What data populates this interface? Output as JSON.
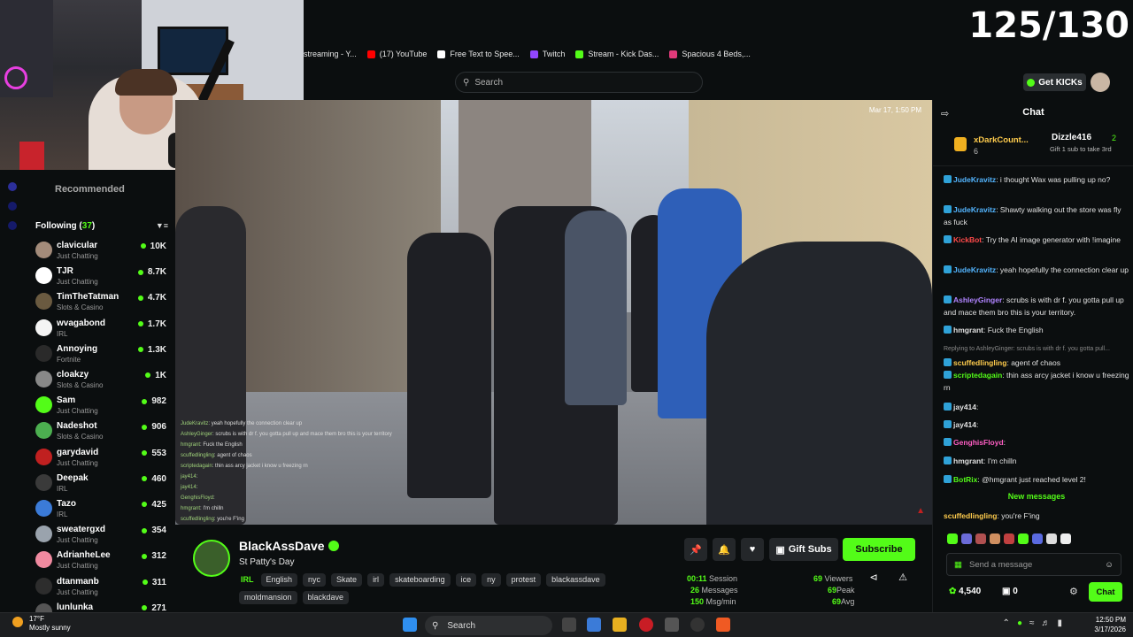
{
  "overlay": {
    "score": "125/130"
  },
  "bookmarks": [
    {
      "label": "streaming - Y...",
      "color": "#ff3d3d"
    },
    {
      "label": "(17) YouTube",
      "color": "#ff0000"
    },
    {
      "label": "Free Text to Spee...",
      "color": "#ffffff"
    },
    {
      "label": "Twitch",
      "color": "#9146ff"
    },
    {
      "label": "Stream - Kick Das...",
      "color": "#53fc18"
    },
    {
      "label": "Spacious 4 Beds,...",
      "color": "#e03a7a"
    }
  ],
  "header": {
    "search_placeholder": "Search",
    "get_kicks": "Get KICKs"
  },
  "sidebar": {
    "recommended": "Recommended",
    "following_label": "Following (",
    "following_count": "37",
    "following_close": ")",
    "channels": [
      {
        "name": "clavicular",
        "category": "Just Chatting",
        "viewers": "10K",
        "color": "#a38b7a"
      },
      {
        "name": "TJR",
        "category": "Just Chatting",
        "viewers": "8.7K",
        "color": "#ffffff"
      },
      {
        "name": "TimTheTatman",
        "category": "Slots & Casino",
        "viewers": "4.7K",
        "color": "#6a5a40"
      },
      {
        "name": "wvagabond",
        "category": "IRL",
        "viewers": "1.7K",
        "color": "#f4f4f4"
      },
      {
        "name": "Annoying",
        "category": "Fortnite",
        "viewers": "1.3K",
        "color": "#2a2a2a"
      },
      {
        "name": "cloakzy",
        "category": "Slots & Casino",
        "viewers": "1K",
        "color": "#888888"
      },
      {
        "name": "Sam",
        "category": "Just Chatting",
        "viewers": "982",
        "color": "#53fc18"
      },
      {
        "name": "Nadeshot",
        "category": "Slots & Casino",
        "viewers": "906",
        "color": "#4caf50"
      },
      {
        "name": "garydavid",
        "category": "Just Chatting",
        "viewers": "553",
        "color": "#c02020"
      },
      {
        "name": "Deepak",
        "category": "IRL",
        "viewers": "460",
        "color": "#3a3a3a"
      },
      {
        "name": "Tazo",
        "category": "IRL",
        "viewers": "425",
        "color": "#3b7bd8"
      },
      {
        "name": "sweatergxd",
        "category": "Just Chatting",
        "viewers": "354",
        "color": "#9aa3ad"
      },
      {
        "name": "AdrianheLee",
        "category": "Just Chatting",
        "viewers": "312",
        "color": "#f08aa0"
      },
      {
        "name": "dtanmanb",
        "category": "Just Chatting",
        "viewers": "311",
        "color": "#2d2d2d"
      },
      {
        "name": "lunlunka",
        "category": "",
        "viewers": "271",
        "color": "#555555"
      }
    ]
  },
  "video": {
    "timestamp": "Mar 17, 1:50 PM",
    "overlay_chat": [
      {
        "user": "JudeKravitz",
        "text": "yeah hopefully the connection clear up"
      },
      {
        "user": "AshleyGinger",
        "text": "scrubs is with dr f. you gotta pull up and mace them bro this is your territory"
      },
      {
        "user": "hmgrant",
        "text": "Fuck the English"
      },
      {
        "user": "scuffedlingling",
        "text": "agent of chaos"
      },
      {
        "user": "scriptedagain",
        "text": "thin ass arcy jacket i know u freezing rn"
      },
      {
        "user": "jay414",
        "text": ""
      },
      {
        "user": "jay414",
        "text": ""
      },
      {
        "user": "GenghisFloyd",
        "text": ""
      },
      {
        "user": "hmgrant",
        "text": "I'm chilln"
      },
      {
        "user": "scuffedlingling",
        "text": "you're F'ing"
      }
    ]
  },
  "stream": {
    "streamer": "BlackAssDave",
    "title": "St Patty's Day",
    "category": "IRL",
    "tags": [
      "English",
      "nyc",
      "Skate",
      "irl",
      "skateboarding",
      "ice",
      "ny",
      "protest",
      "blackassdave",
      "moldmansion",
      "blackdave"
    ],
    "gift_subs": "Gift Subs",
    "subscribe": "Subscribe",
    "stats": [
      {
        "value": "00:11",
        "label": "Session"
      },
      {
        "value": "26",
        "label": "Messages"
      },
      {
        "value": "150",
        "label": "Msg/min"
      }
    ],
    "stats2": [
      {
        "value": "69",
        "label": "Viewers"
      },
      {
        "value": "69",
        "label": "Peak"
      },
      {
        "value": "69",
        "label": "Avg"
      }
    ]
  },
  "chat": {
    "title": "Chat",
    "pinned": {
      "user1": "xDarkCount...",
      "count1": "6",
      "user2": "Dizzle416",
      "count2": "2",
      "note": "Gift 1 sub to take 3rd"
    },
    "messages": [
      {
        "user": "JudeKravitz",
        "color": "#53b5ff",
        "text": "i thought Wax was pulling up no?"
      },
      {
        "user": "JudeKravitz",
        "color": "#53b5ff",
        "text": "Shawty walking out the store was fly as fuck"
      },
      {
        "user": "KickBot",
        "color": "#ff4a4a",
        "text": "Try the AI image generator with !imagine"
      },
      {
        "user": "JudeKravitz",
        "color": "#53b5ff",
        "text": "yeah hopefully the connection clear up"
      },
      {
        "user": "AshleyGinger",
        "color": "#b084ff",
        "text": "scrubs is with dr f. you gotta pull up and mace them bro this is your territory."
      },
      {
        "user": "hmgrant",
        "color": "#e0e0e0",
        "text": "Fuck the English"
      },
      {
        "user": "scuffedlingling",
        "color": "#ffcc4d",
        "text": "agent of chaos",
        "reply": "Replying to AshleyGinger: scrubs is with dr f. you gotta pull..."
      },
      {
        "user": "scriptedagain",
        "color": "#53fc18",
        "text": "thin ass arcy jacket i know u freezing rn"
      },
      {
        "user": "jay414",
        "color": "#e0e0e0",
        "text": ""
      },
      {
        "user": "jay414",
        "color": "#e0e0e0",
        "text": ""
      },
      {
        "user": "GenghisFloyd",
        "color": "#ff5ec4",
        "text": ""
      },
      {
        "user": "hmgrant",
        "color": "#e0e0e0",
        "text": "I'm chilln"
      },
      {
        "user": "BotRix",
        "color": "#53fc18",
        "text": "@hmgrant just reached level 2!"
      }
    ],
    "new_messages": "New messages",
    "last": {
      "user": "scuffedlingling",
      "text": "you're F'ing"
    },
    "input_placeholder": "Send a message",
    "kicks": "4,540",
    "streak": "0",
    "send": "Chat"
  },
  "taskbar": {
    "temp": "17°F",
    "weather": "Mostly sunny",
    "search": "Search",
    "time": "12:50 PM",
    "date": "3/17/2026"
  }
}
